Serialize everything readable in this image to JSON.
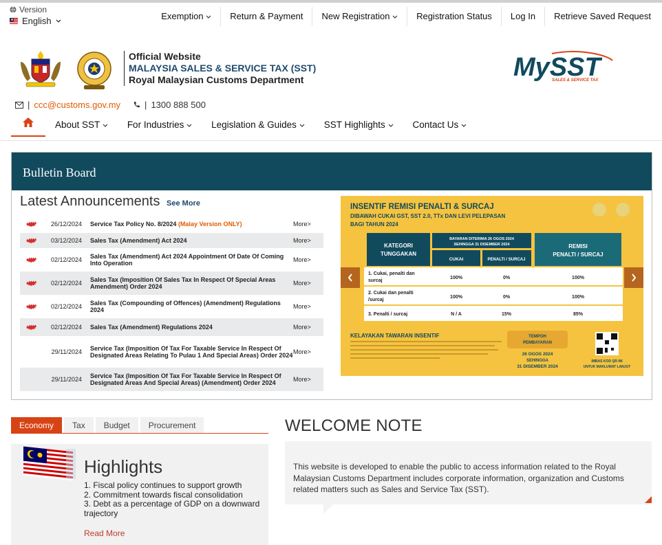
{
  "utility": {
    "version_label": "Version",
    "language": "English"
  },
  "top_nav": [
    {
      "label": "Exemption",
      "dropdown": true
    },
    {
      "label": "Return & Payment",
      "dropdown": false
    },
    {
      "label": "New Registration",
      "dropdown": true
    },
    {
      "label": "Registration Status",
      "dropdown": false
    },
    {
      "label": "Log In",
      "dropdown": false
    },
    {
      "label": "Retrieve Saved Request",
      "dropdown": false
    }
  ],
  "header": {
    "line1": "Official Website",
    "line2": "MALAYSIA SALES & SERVICE TAX (SST)",
    "line3": "Royal Malaysian Customs Department",
    "logo_text": "MySST",
    "logo_tagline": "SALES & SERVICE TAX"
  },
  "contact": {
    "email": "ccc@customs.gov.my",
    "phone": "1300 888 500"
  },
  "main_nav": [
    {
      "label": "About SST",
      "dropdown": true
    },
    {
      "label": "For Industries",
      "dropdown": true
    },
    {
      "label": "Legislation & Guides",
      "dropdown": true
    },
    {
      "label": "SST Highlights",
      "dropdown": true
    },
    {
      "label": "Contact Us",
      "dropdown": true
    }
  ],
  "bulletin": {
    "title": "Bulletin Board",
    "announcements_title": "Latest Announcements",
    "see_more": "See More",
    "more_label": "More>",
    "announcements": [
      {
        "date": "26/12/2024",
        "title": "Service Tax Policy No. 8/2024",
        "note": "(Malay Version ONLY)",
        "is_new": true
      },
      {
        "date": "03/12/2024",
        "title": "Sales Tax (Amendment) Act 2024",
        "note": "",
        "is_new": true
      },
      {
        "date": "02/12/2024",
        "title": "Sales Tax (Amendment) Act 2024 Appointment Of Date Of Coming Into Operation",
        "note": "",
        "is_new": true
      },
      {
        "date": "02/12/2024",
        "title": "Sales Tax (Imposition Of Sales Tax In Respect Of Special Areas Amendment) Order 2024",
        "note": "",
        "is_new": true
      },
      {
        "date": "02/12/2024",
        "title": "Sales Tax (Compounding of Offences) (Amendment) Regulations 2024",
        "note": "",
        "is_new": true
      },
      {
        "date": "02/12/2024",
        "title": "Sales Tax (Amendment) Regulations 2024",
        "note": "",
        "is_new": true
      },
      {
        "date": "29/11/2024",
        "title": "Service Tax (Imposition Of Tax For Taxable Service In Respect Of Designated Areas Relating To Pulau 1 And Special Areas) Order 2024",
        "note": "",
        "is_new": false
      },
      {
        "date": "29/11/2024",
        "title": "Service Tax (Imposition Of Tax For Taxable Service In Respect Of Designated Areas And Special Areas) (Amendment) Order 2024",
        "note": "",
        "is_new": false
      }
    ],
    "banner": {
      "title": "INSENTIF REMISI PENALTI & SURCAJ",
      "subtitle_1": "DIBAWAH CUKAI GST, SST 2.0, TTx DAN LEVI PELEPASAN",
      "subtitle_2": "BAGI TAHUN 2024",
      "col_category_1": "KATEGORI",
      "col_category_2": "TUNGGAKAN",
      "col_pay_1": "BAYARAN DITERIMA 26 OGOS 2024",
      "col_pay_2": "SEHINGGA 31 DISEMBER 2024",
      "col_tax": "CUKAI",
      "col_penalty": "PENALTI / SURCAJ",
      "col_remission_1": "REMISI",
      "col_remission_2": "PENALTI / SURCAJ",
      "rows": [
        {
          "cat_1": "1. Cukai, penalti dan",
          "cat_2": "surcaj",
          "tax": "100%",
          "penalty": "0%",
          "remission": "100%"
        },
        {
          "cat_1": "2. Cukai dan penalti",
          "cat_2": "/surcaj",
          "tax": "100%",
          "penalty": "0%",
          "remission": "100%"
        },
        {
          "cat_1": "3. Penalti / surcaj",
          "cat_2": "",
          "tax": "N / A",
          "penalty": "15%",
          "remission": "85%"
        }
      ],
      "eligibility_title": "KELAYAKAN TAWARAN INSENTIF",
      "period_label_1": "TEMPOH",
      "period_label_2": "PEMBAYARAN",
      "period_1": "26 OGOS 2024",
      "period_2": "SEHINGGA",
      "period_3": "31 DISEMBER 2024",
      "qr_text_1": "IMBAS KOD QR INI",
      "qr_text_2": "UNTUK MAKLUMAT LANJUT"
    }
  },
  "tabs": {
    "items": [
      "Economy",
      "Tax",
      "Budget",
      "Procurement"
    ],
    "active": "Economy",
    "highlights_title": "Highlights",
    "highlights": [
      "1. Fiscal policy continues to support growth",
      "2. Commitment towards fiscal consolidation",
      "3. Debt as a percentage of GDP on a downward trajectory"
    ],
    "read_more": "Read More"
  },
  "welcome": {
    "title": "WELCOME NOTE",
    "text": "This website is developed to enable the public to access information related to the Royal Malaysian Customs Department includes corporate information, organization and Customs related matters such as Sales and Service Tax (SST)."
  },
  "colors": {
    "accent": "#d84315",
    "bulletin_header": "#114a5d",
    "banner_bg": "#f5c33f",
    "link_blue": "#1d4a6e"
  }
}
